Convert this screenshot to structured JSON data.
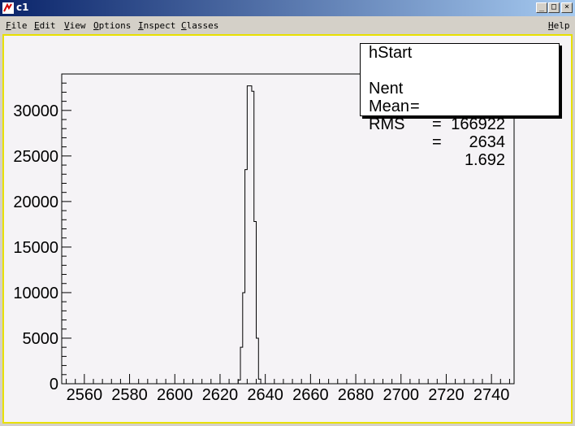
{
  "window": {
    "title": "c1",
    "minimize_glyph": "_",
    "maximize_glyph": "□",
    "close_glyph": "×"
  },
  "menu": {
    "items": [
      "File",
      "Edit",
      "View",
      "Options",
      "Inspect",
      "Classes"
    ],
    "help": "Help"
  },
  "stats": {
    "name": "hStart",
    "entries_label": "Nent",
    "entries_value": "166922",
    "mean_label": "Mean",
    "mean_value": "2634",
    "rms_label": "RMS",
    "rms_value": "1.692"
  },
  "colors": {
    "titlebar_start": "#0a246a",
    "titlebar_end": "#a6caf0",
    "canvas_border": "#e8e000",
    "canvas_bg": "#f5f3f6"
  },
  "chart_data": {
    "type": "bar",
    "xlim": [
      2550,
      2750
    ],
    "ylim": [
      0,
      34000
    ],
    "yticks": [
      0,
      5000,
      10000,
      15000,
      20000,
      25000,
      30000
    ],
    "ytick_labels": [
      "0",
      "5000",
      "10000",
      "15000",
      "20000",
      "25000",
      "30000"
    ],
    "xticks": [
      2560,
      2580,
      2600,
      2620,
      2640,
      2660,
      2680,
      2700,
      2720,
      2740
    ],
    "xtick_labels": [
      "2560",
      "2580",
      "2600",
      "2620",
      "2640",
      "2660",
      "2680",
      "2700",
      "2720",
      "2740"
    ],
    "bin_width": 1,
    "bins": [
      {
        "x": 2627,
        "y": 0
      },
      {
        "x": 2628,
        "y": 400
      },
      {
        "x": 2629,
        "y": 4000
      },
      {
        "x": 2630,
        "y": 10000
      },
      {
        "x": 2631,
        "y": 23500
      },
      {
        "x": 2632,
        "y": 32700
      },
      {
        "x": 2633,
        "y": 32700
      },
      {
        "x": 2634,
        "y": 32100
      },
      {
        "x": 2635,
        "y": 17800
      },
      {
        "x": 2636,
        "y": 5000
      },
      {
        "x": 2637,
        "y": 500
      },
      {
        "x": 2638,
        "y": 0
      }
    ]
  }
}
